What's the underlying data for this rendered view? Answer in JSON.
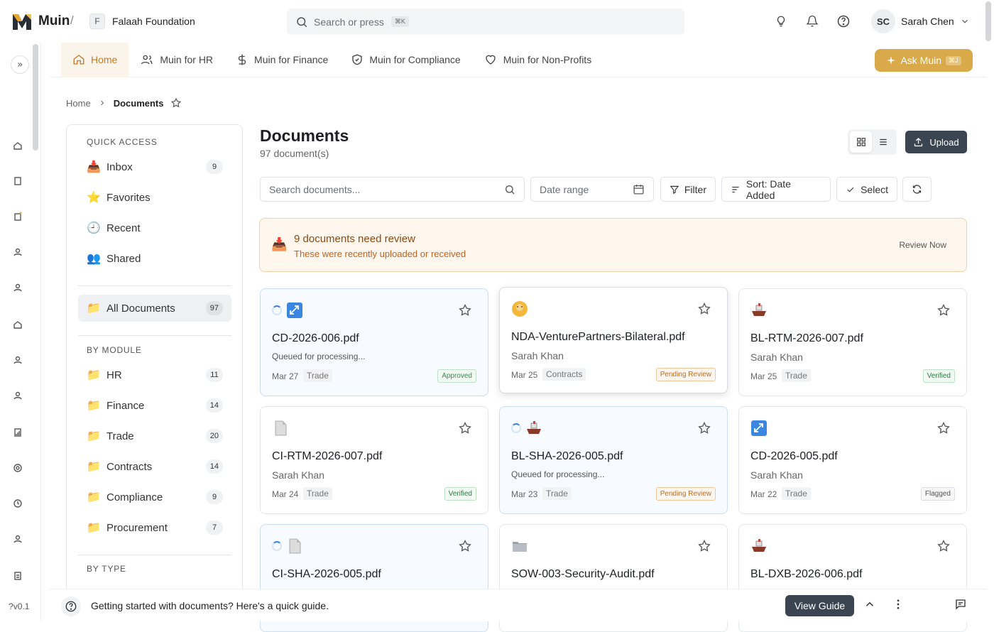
{
  "app": {
    "name": "Muin",
    "org_initial": "F",
    "org_name": "Falaah Foundation",
    "version": "v0.1"
  },
  "topbar": {
    "search_placeholder": "Search or press",
    "search_kbd": "⌘K",
    "user_initials": "SC",
    "user_name": "Sarah Chen"
  },
  "nav": {
    "items": [
      {
        "label": "Home",
        "icon": "home-icon",
        "active": true
      },
      {
        "label": "Muin for HR",
        "icon": "users-icon",
        "active": false
      },
      {
        "label": "Muin for Finance",
        "icon": "dollar-icon",
        "active": false
      },
      {
        "label": "Muin for Compliance",
        "icon": "shield-icon",
        "active": false
      },
      {
        "label": "Muin for Non-Profits",
        "icon": "heart-icon",
        "active": false
      }
    ],
    "ask_label": "Ask Muin",
    "ask_kbd": "⌘J"
  },
  "breadcrumb": {
    "home": "Home",
    "current": "Documents"
  },
  "sidebar": {
    "quick_access_title": "QUICK ACCESS",
    "quick_access": [
      {
        "label": "Inbox",
        "emoji": "📥",
        "count": "9"
      },
      {
        "label": "Favorites",
        "emoji": "⭐",
        "count": ""
      },
      {
        "label": "Recent",
        "emoji": "🕘",
        "count": ""
      },
      {
        "label": "Shared",
        "emoji": "👥",
        "count": ""
      }
    ],
    "all_docs": {
      "label": "All Documents",
      "count": "97"
    },
    "by_module_title": "BY MODULE",
    "modules": [
      {
        "label": "HR",
        "count": "11"
      },
      {
        "label": "Finance",
        "count": "14"
      },
      {
        "label": "Trade",
        "count": "20"
      },
      {
        "label": "Contracts",
        "count": "14"
      },
      {
        "label": "Compliance",
        "count": "9"
      },
      {
        "label": "Procurement",
        "count": "7"
      }
    ],
    "by_type_title": "BY TYPE"
  },
  "main": {
    "title": "Documents",
    "subtitle": "97 document(s)",
    "upload_label": "Upload",
    "search_placeholder": "Search documents...",
    "date_placeholder": "Date range",
    "filter_label": "Filter",
    "sort_label": "Sort: Date Added",
    "select_label": "Select"
  },
  "review": {
    "title": "9 documents need review",
    "subtitle": "These were recently uploaded or received",
    "button": "Review Now"
  },
  "cards": [
    {
      "name": "CD-2026-006.pdf",
      "by": "Queued for processing...",
      "date": "Mar 27",
      "tag": "Trade",
      "status": "Approved",
      "icon": "customs-icon",
      "processing": true
    },
    {
      "name": "NDA-VenturePartners-Bilateral.pdf",
      "by": "Sarah Khan",
      "date": "Mar 25",
      "tag": "Contracts",
      "status": "Pending Review",
      "icon": "face-icon",
      "processing": false
    },
    {
      "name": "BL-RTM-2026-007.pdf",
      "by": "Sarah Khan",
      "date": "Mar 25",
      "tag": "Trade",
      "status": "Verified",
      "icon": "ship-icon",
      "processing": false
    },
    {
      "name": "CI-RTM-2026-007.pdf",
      "by": "Sarah Khan",
      "date": "Mar 24",
      "tag": "Trade",
      "status": "Verified",
      "icon": "page-icon",
      "processing": false
    },
    {
      "name": "BL-SHA-2026-005.pdf",
      "by": "Queued for processing...",
      "date": "Mar 23",
      "tag": "Trade",
      "status": "Pending Review",
      "icon": "ship-icon",
      "processing": true
    },
    {
      "name": "CD-2026-005.pdf",
      "by": "Sarah Khan",
      "date": "Mar 22",
      "tag": "Trade",
      "status": "Flagged",
      "icon": "customs-icon",
      "processing": false
    },
    {
      "name": "CI-SHA-2026-005.pdf",
      "icon": "page-icon",
      "processing": true
    },
    {
      "name": "SOW-003-Security-Audit.pdf",
      "icon": "folder-icon",
      "processing": false
    },
    {
      "name": "BL-DXB-2026-006.pdf",
      "icon": "ship-icon",
      "processing": false
    }
  ],
  "bottom": {
    "message": "Getting started with documents? Here's a quick guide.",
    "guide_label": "View Guide"
  },
  "colors": {
    "accent": "#d9a94a",
    "active_nav": "#c27a2c",
    "dark_button": "#3b4552",
    "review_bg": "#fff6ee"
  }
}
